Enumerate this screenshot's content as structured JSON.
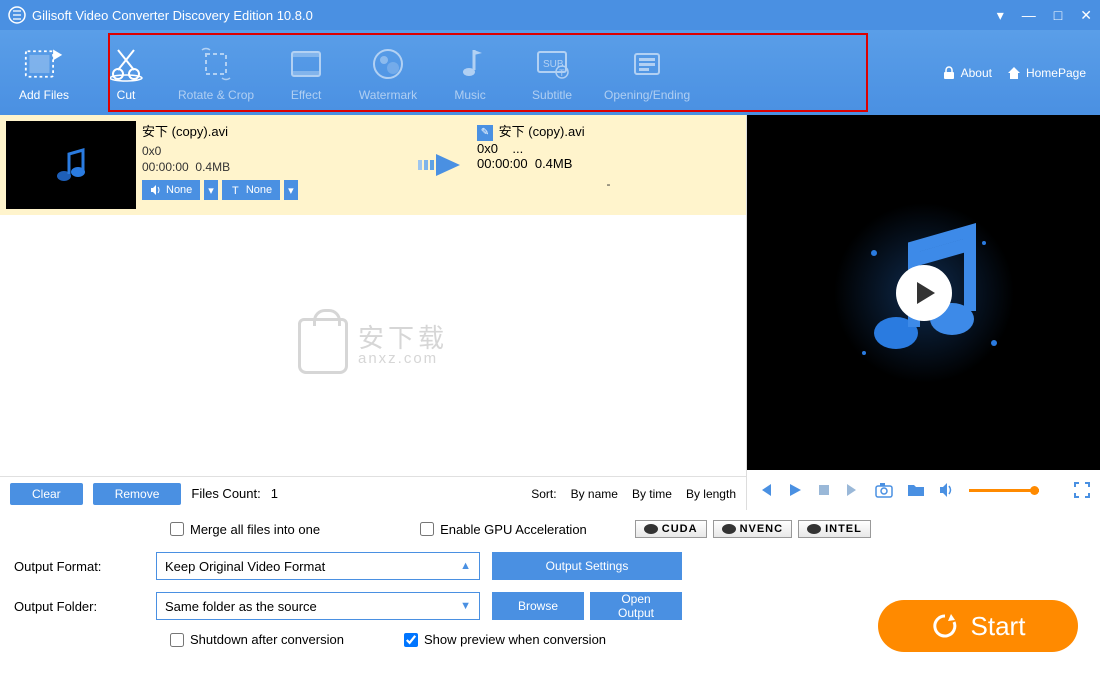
{
  "titlebar": {
    "title": "Gilisoft Video Converter Discovery Edition 10.8.0"
  },
  "toolbar": {
    "add_files": "Add Files",
    "items": [
      {
        "label": "Cut"
      },
      {
        "label": "Rotate & Crop"
      },
      {
        "label": "Effect"
      },
      {
        "label": "Watermark"
      },
      {
        "label": "Music"
      },
      {
        "label": "Subtitle"
      },
      {
        "label": "Opening/Ending"
      }
    ],
    "about": "About",
    "homepage": "HomePage"
  },
  "file_row": {
    "src": {
      "name": "安下 (copy).avi",
      "dim": "0x0",
      "duration": "00:00:00",
      "size": "0.4MB"
    },
    "dst": {
      "name": "安下 (copy).avi",
      "dim": "0x0",
      "ellipsis": "...",
      "duration": "00:00:00",
      "size": "0.4MB"
    },
    "audio_btn": "None",
    "subtitle_btn": "None",
    "dash": "-"
  },
  "watermark_overlay": {
    "main": "安下载",
    "sub": "anxz.com"
  },
  "action_bar": {
    "clear": "Clear",
    "remove": "Remove",
    "files_count_label": "Files Count:",
    "files_count_value": "1",
    "sort_label": "Sort:",
    "sort_by_name": "By name",
    "sort_by_time": "By time",
    "sort_by_length": "By length"
  },
  "options": {
    "merge": "Merge all files into one",
    "gpu": "Enable GPU Acceleration",
    "badges": {
      "cuda": "CUDA",
      "nvenc": "NVENC",
      "intel": "INTEL"
    },
    "format_label": "Output Format:",
    "format_value": "Keep Original Video Format",
    "folder_label": "Output Folder:",
    "folder_value": "Same folder as the source",
    "output_settings": "Output Settings",
    "browse": "Browse",
    "open_output": "Open Output",
    "shutdown": "Shutdown after conversion",
    "show_preview": "Show preview when conversion",
    "start": "Start"
  }
}
